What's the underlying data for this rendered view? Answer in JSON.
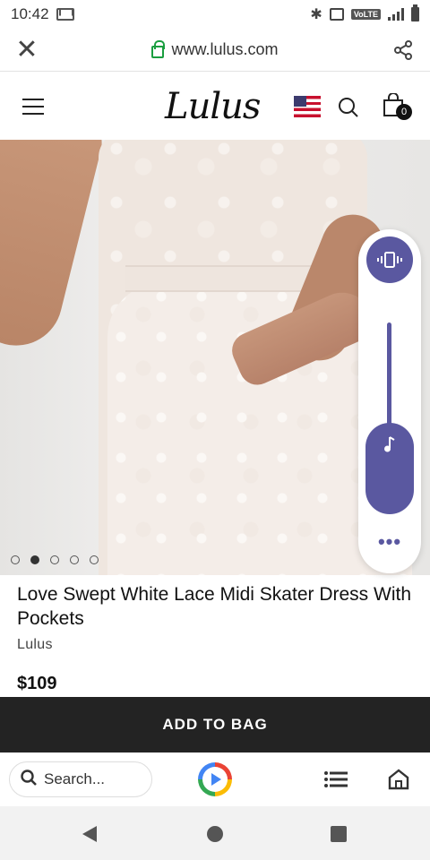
{
  "status": {
    "time": "10:42",
    "network": "VoLTE",
    "icons": [
      "gmail-icon",
      "bluetooth-icon",
      "vibrate-icon",
      "signal-icon",
      "battery-icon"
    ]
  },
  "browser": {
    "url": "www.lulus.com",
    "close_icon": "close-icon",
    "share_icon": "share-icon"
  },
  "site_header": {
    "logo": "Lulus",
    "bag_count": "0",
    "icons": [
      "menu-icon",
      "us-flag-icon",
      "search-icon",
      "shopping-bag-icon"
    ]
  },
  "product": {
    "title": "Love Swept White Lace Midi Skater Dress With Pockets",
    "brand": "Lulus",
    "price": "$109",
    "image_count": 5,
    "active_image_index": 1
  },
  "cta": {
    "add_to_bag": "ADD TO BAG"
  },
  "volume_panel": {
    "mode_icon": "vibrate-icon",
    "stream_icon": "music-note-icon",
    "more_icon": "more-horizontal-icon",
    "level": 0.3
  },
  "bottom_toolbar": {
    "search_placeholder": "Search...",
    "icons": [
      "google-play-icon",
      "list-icon",
      "home-icon"
    ]
  },
  "colors": {
    "accent": "#5a58a0",
    "cta_bg": "#232323",
    "secure_green": "#1a9e3f"
  }
}
